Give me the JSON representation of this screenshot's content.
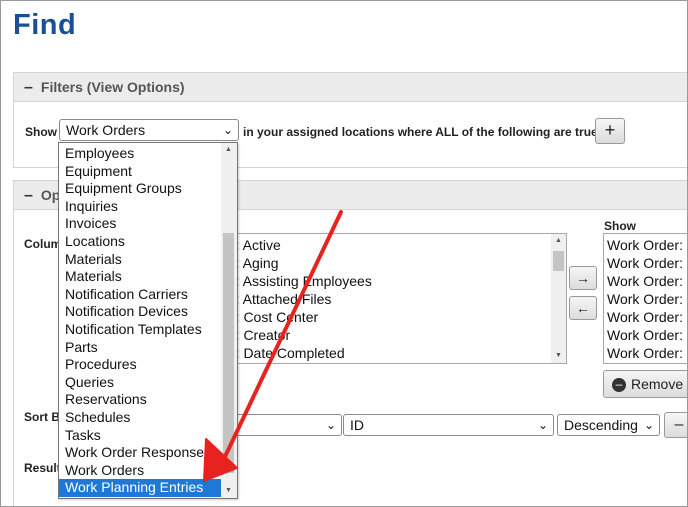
{
  "page": {
    "title": "Find"
  },
  "filters": {
    "header": "Filters (View Options)",
    "show_label": "Show",
    "show_value": "Work Orders",
    "condition_text": "in your assigned locations where ALL of the following are true:",
    "add_label": "+"
  },
  "options": {
    "header_visible": "Op",
    "columns_label": "Colum",
    "available_columns": [
      "r: Active",
      "r: Aging",
      "r: Assisting Employees",
      "r: Attached Files",
      "r: Cost Center",
      "r: Creator",
      "r: Date Completed"
    ],
    "move_right_label": "→",
    "move_left_label": "←",
    "show_label": "Show",
    "show_columns": [
      "Work Order:",
      "Work Order:",
      "Work Order:",
      "Work Order:",
      "Work Order:",
      "Work Order:",
      "Work Order:"
    ],
    "remove_label": "Remove",
    "sort_label": "Sort B",
    "sort_field1": "der",
    "sort_field2": "ID",
    "sort_direction": "Descending",
    "sort_extra": "–",
    "results_label": "Result"
  },
  "dropdown": {
    "options": [
      "Employees",
      "Equipment",
      "Equipment Groups",
      "Inquiries",
      "Invoices",
      "Locations",
      "Materials",
      "Materials",
      "Notification Carriers",
      "Notification Devices",
      "Notification Templates",
      "Parts",
      "Procedures",
      "Queries",
      "Reservations",
      "Schedules",
      "Tasks",
      "Work Order Responses",
      "Work Orders",
      "Work Planning Entries"
    ],
    "selected_index": 19
  },
  "colors": {
    "title": "#1a4f96",
    "annotation_arrow": "#e8231f",
    "selection": "#1e78d6"
  }
}
